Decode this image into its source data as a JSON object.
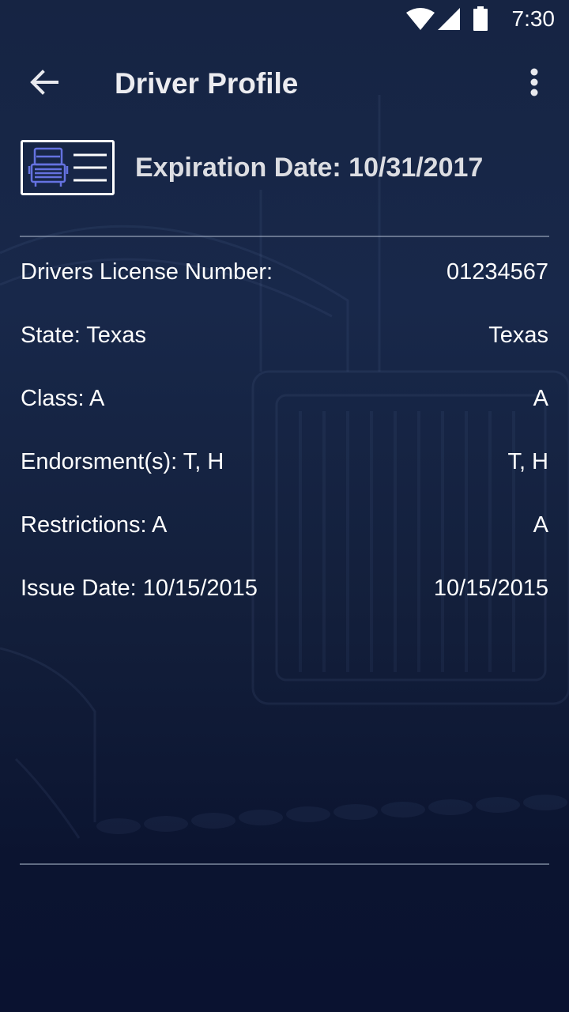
{
  "status_bar": {
    "time": "7:30",
    "icons": [
      "wifi-icon",
      "cell-signal-icon",
      "battery-icon"
    ]
  },
  "app_bar": {
    "title": "Driver Profile",
    "back_icon": "arrow-left-icon",
    "menu_icon": "more-vertical-icon"
  },
  "license": {
    "icon": "license-card-truck-icon",
    "expiration": "Expiration Date: 10/31/2017"
  },
  "rows": [
    {
      "label": "Drivers License Number:",
      "value": "01234567"
    },
    {
      "label": "State: Texas",
      "value": "Texas"
    },
    {
      "label": "Class: A",
      "value": "A"
    },
    {
      "label": "Endorsment(s): T, H",
      "value": "T, H"
    },
    {
      "label": "Restrictions: A",
      "value": "A"
    },
    {
      "label": "Issue Date: 10/15/2015",
      "value": "10/15/2015"
    }
  ],
  "colors": {
    "background_top": "#162443",
    "background_bottom": "#0a1230",
    "text": "#ffffff",
    "icon_accent": "#5b6bd8"
  }
}
